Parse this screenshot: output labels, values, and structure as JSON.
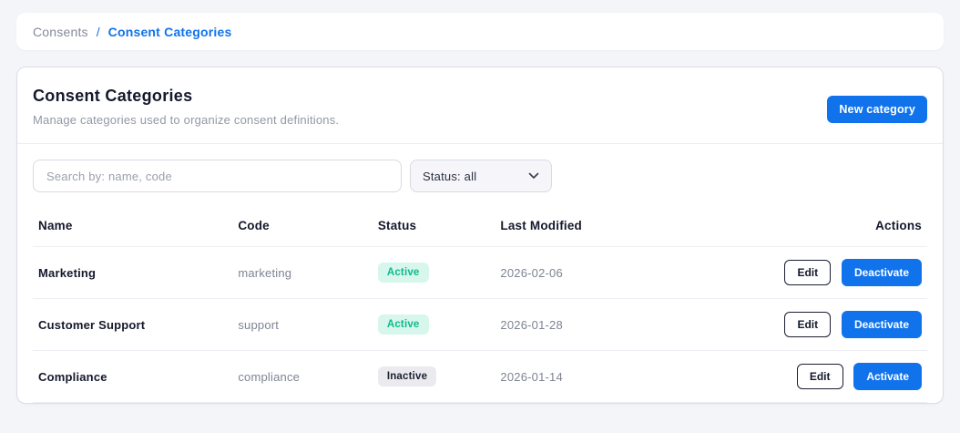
{
  "breadcrumb": {
    "separator": "/",
    "items": [
      {
        "label": "Consents",
        "active": false
      },
      {
        "label": "Consent Categories",
        "active": true
      }
    ]
  },
  "header": {
    "title": "Consent Categories",
    "subtitle": "Manage categories used to organize consent definitions.",
    "new_category_label": "New category"
  },
  "filters": {
    "search_placeholder": "Search by: name, code",
    "status_value": "Status: all"
  },
  "table": {
    "columns": [
      "Name",
      "Code",
      "Status",
      "Last Modified",
      "Actions"
    ],
    "rows": [
      {
        "name": "Marketing",
        "code": "marketing",
        "status": "Active",
        "status_type": "active",
        "last_modified": "2026-02-06",
        "actions": [
          "Edit",
          "Deactivate"
        ]
      },
      {
        "name": "Customer Support",
        "code": "support",
        "status": "Active",
        "status_type": "active",
        "last_modified": "2026-01-28",
        "actions": [
          "Edit",
          "Deactivate"
        ]
      },
      {
        "name": "Compliance",
        "code": "compliance",
        "status": "Inactive",
        "status_type": "inactive",
        "last_modified": "2026-01-14",
        "actions": [
          "Edit",
          "Activate"
        ]
      }
    ]
  },
  "colors": {
    "accent_blue": "#1173EB",
    "active_badge_bg": "#D7F6EC",
    "active_badge_text": "#10B98D",
    "inactive_badge_bg": "#EAEAEF",
    "inactive_badge_text": "#1B1F31"
  }
}
